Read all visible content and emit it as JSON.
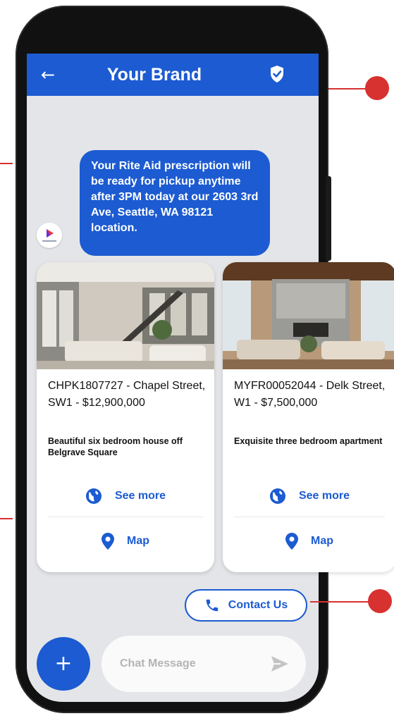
{
  "header": {
    "back_icon": "arrow-left-icon",
    "title": "Your Brand",
    "verified_icon": "shield-check-icon"
  },
  "message": {
    "sender_icon": "brand-logo-icon",
    "text": "Your Rite Aid prescription will be ready for pickup anytime after 3PM today at our 2603 3rd Ave, Seattle, WA 98121 location."
  },
  "cards": [
    {
      "title": "CHPK1807727 - Chapel Street, SW1 - $12,900,000",
      "description": "Beautiful six bedroom house off Belgrave Square",
      "see_more_label": "See more",
      "map_label": "Map"
    },
    {
      "title": "MYFR00052044 - Delk Street, W1 - $7,500,000",
      "description": "Exquisite three bedroom apartment",
      "see_more_label": "See more",
      "map_label": "Map"
    }
  ],
  "contact": {
    "label": "Contact Us",
    "icon": "phone-icon"
  },
  "composer": {
    "add_label": "+",
    "placeholder": "Chat Message",
    "send_icon": "send-icon"
  },
  "colors": {
    "brand_blue": "#1c5bd1",
    "callout_red": "#d7322f",
    "chat_bg": "#e4e5e8"
  }
}
